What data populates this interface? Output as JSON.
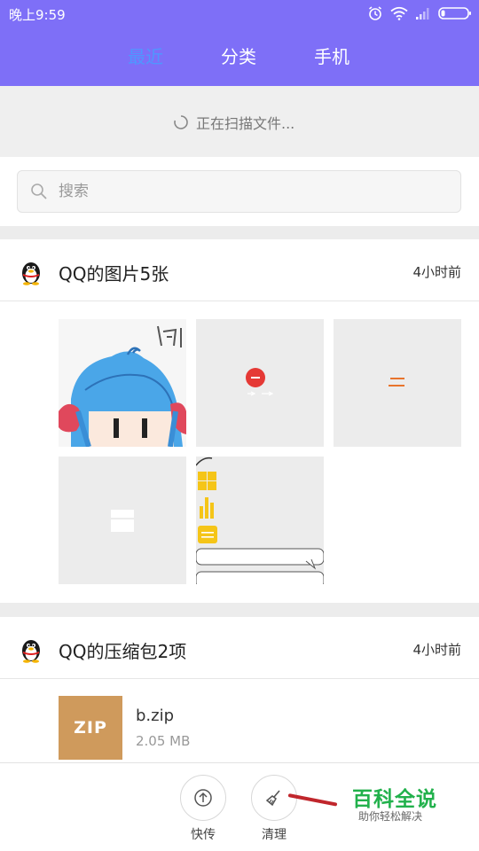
{
  "status_bar": {
    "time": "晚上9:59"
  },
  "tabs": [
    {
      "label": "最近",
      "active": true
    },
    {
      "label": "分类",
      "active": false
    },
    {
      "label": "手机",
      "active": false
    }
  ],
  "scan": {
    "text": "正在扫描文件..."
  },
  "search": {
    "placeholder": "搜索"
  },
  "sections": [
    {
      "title": "QQ的图片5张",
      "time": "4小时前"
    },
    {
      "title": "QQ的压缩包2项",
      "time": "4小时前"
    }
  ],
  "zip_file": {
    "icon_label": "ZIP",
    "name": "b.zip",
    "size": "2.05 MB"
  },
  "actions": [
    {
      "label": "快传",
      "icon": "upload-icon"
    },
    {
      "label": "清理",
      "icon": "broom-icon"
    }
  ],
  "watermark": {
    "title": "百科全说",
    "subtitle": "助你轻松解决"
  },
  "colors": {
    "header": "#7e6ff7",
    "active_tab": "#4f97ff",
    "zip_icon": "#cf9a5c",
    "watermark_green": "#22b14c"
  }
}
